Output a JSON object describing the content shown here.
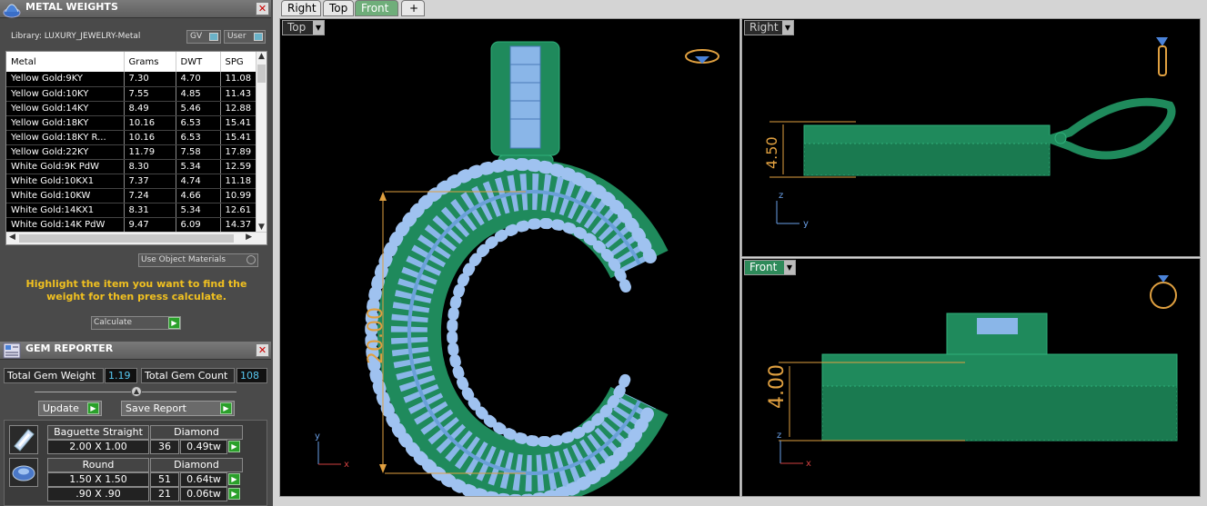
{
  "metal_weights": {
    "title": "METAL WEIGHTS",
    "library_label": "Library: LUXURY_JEWELRY-Metal",
    "gv_label": "GV",
    "user_label": "User",
    "columns": [
      "Metal",
      "Grams",
      "DWT",
      "SPG"
    ],
    "rows": [
      [
        "Yellow Gold:9KY",
        "7.30",
        "4.70",
        "11.08"
      ],
      [
        "Yellow Gold:10KY",
        "7.55",
        "4.85",
        "11.43"
      ],
      [
        "Yellow Gold:14KY",
        "8.49",
        "5.46",
        "12.88"
      ],
      [
        "Yellow Gold:18KY",
        "10.16",
        "6.53",
        "15.41"
      ],
      [
        "Yellow Gold:18KY R...",
        "10.16",
        "6.53",
        "15.41"
      ],
      [
        "Yellow Gold:22KY",
        "11.79",
        "7.58",
        "17.89"
      ],
      [
        "White Gold:9K PdW",
        "8.30",
        "5.34",
        "12.59"
      ],
      [
        "White Gold:10KX1",
        "7.37",
        "4.74",
        "11.18"
      ],
      [
        "White Gold:10KW",
        "7.24",
        "4.66",
        "10.99"
      ],
      [
        "White Gold:14KX1",
        "8.31",
        "5.34",
        "12.61"
      ],
      [
        "White Gold:14K PdW",
        "9.47",
        "6.09",
        "14.37"
      ]
    ],
    "use_object_materials": "Use Object Materials",
    "hint": "Highlight the item you want to find the weight for then press calculate.",
    "calculate_label": "Calculate"
  },
  "gem_reporter": {
    "title": "GEM REPORTER",
    "total_weight_label": "Total Gem Weight",
    "total_weight_value": "1.19",
    "total_count_label": "Total Gem Count",
    "total_count_value": "108",
    "update_label": "Update",
    "save_report_label": "Save Report",
    "groups": [
      {
        "shape": "Baguette Straight",
        "material": "Diamond",
        "rows": [
          {
            "size": "2.00 X 1.00",
            "count": "36",
            "weight": "0.49tw"
          }
        ]
      },
      {
        "shape": "Round",
        "material": "Diamond",
        "rows": [
          {
            "size": "1.50 X 1.50",
            "count": "51",
            "weight": "0.64tw"
          },
          {
            "size": ".90 X .90",
            "count": "21",
            "weight": "0.06tw"
          }
        ]
      }
    ]
  },
  "tabs": [
    "Right",
    "Top",
    "Front",
    "+"
  ],
  "active_tab": "Front",
  "viewports": {
    "top": {
      "label": "Top",
      "dimension": "20.00",
      "axis_y": "y",
      "axis_x": "x"
    },
    "right": {
      "label": "Right",
      "dimension": "4.50",
      "axis_z": "z",
      "axis_y": "y"
    },
    "front": {
      "label": "Front",
      "dimension": "4.00",
      "axis_z": "z",
      "axis_x": "x"
    }
  },
  "colors": {
    "model_green": "#1f8a5c",
    "gem_blue": "#8ab6e8",
    "dimension_orange": "#e0a040",
    "panel_bg": "#4a4a4a",
    "hint_yellow": "#f0c020"
  },
  "icons": {
    "metal_weights": "gem-dome-icon",
    "gem_reporter": "gem-report-icon",
    "baguette": "baguette-gem-icon",
    "round": "round-gem-icon",
    "ring": "ring-icon",
    "pendant": "pendant-icon"
  }
}
